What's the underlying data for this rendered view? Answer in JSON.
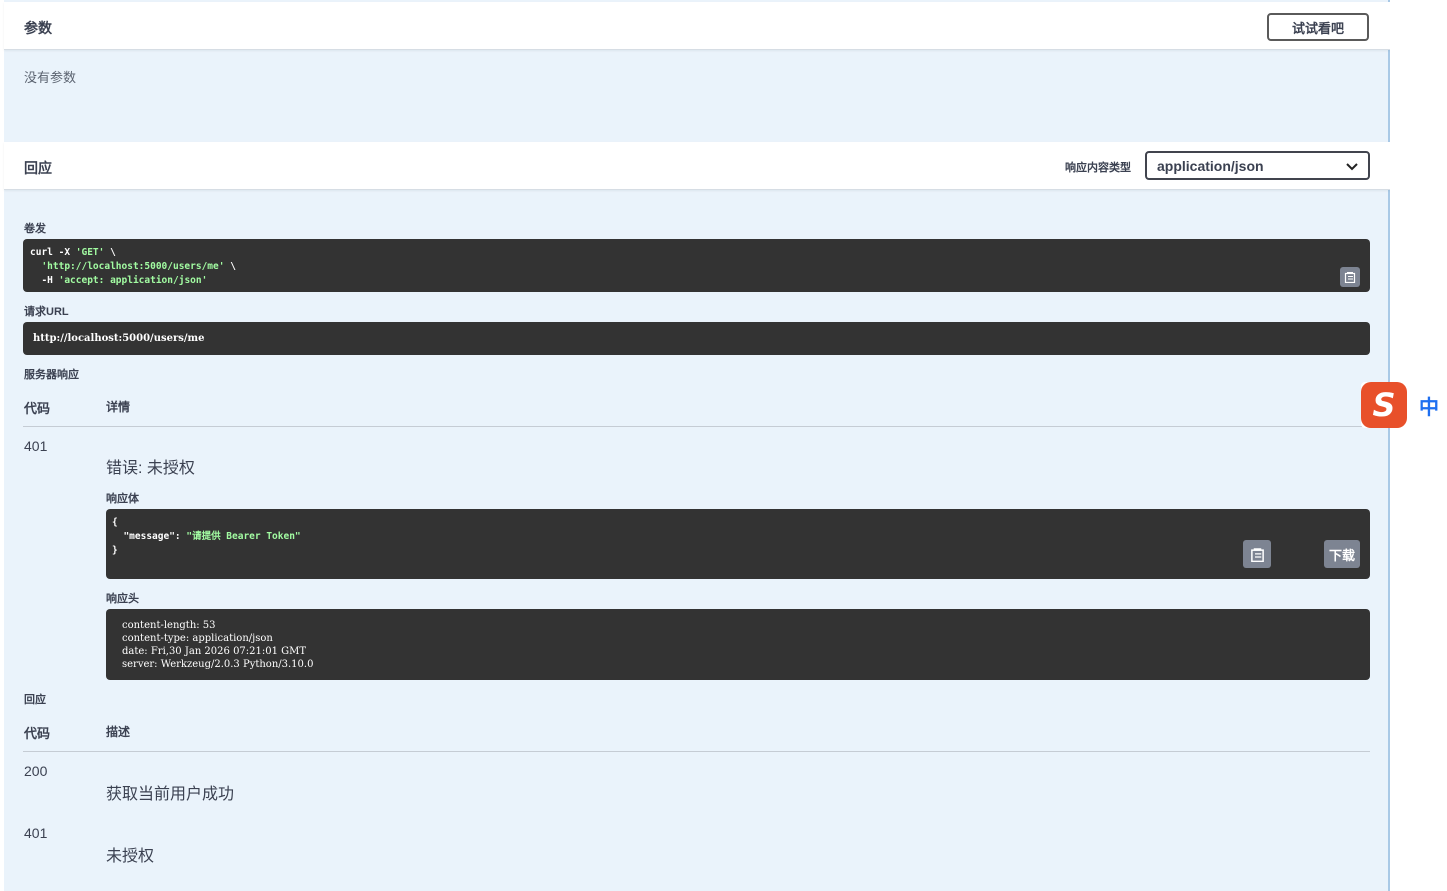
{
  "params": {
    "title": "参数",
    "try_button": "试试看吧",
    "empty_text": "没有参数"
  },
  "responses_header": {
    "title": "回应",
    "content_type_label": "响应内容类型",
    "content_type_value": "application/json"
  },
  "curl": {
    "label": "卷发",
    "line1_cmd": "curl -X ",
    "line1_method": "'GET'",
    "line1_tail": " \\",
    "line2": "  'http://localhost:5000/users/me'",
    "line2_tail": " \\",
    "line3_flag": "  -H ",
    "line3_header": "'accept: application/json'"
  },
  "request_url": {
    "label": "请求URL",
    "value": "http://localhost:5000/users/me"
  },
  "server_response": {
    "label": "服务器响应",
    "col_code": "代码",
    "col_details": "详情",
    "code": "401",
    "error_text": "错误: 未授权",
    "body_label": "响应体",
    "body_open": "{",
    "body_key": "  \"message\": ",
    "body_value": "\"请提供 Bearer Token\"",
    "body_close": "}",
    "download_button": "下载",
    "headers_label": "响应头",
    "headers": [
      "content-length: 53",
      "content-type: application/json",
      "date: Fri,30 Jan 2026 07:21:01 GMT",
      "server: Werkzeug/2.0.3 Python/3.10.0"
    ]
  },
  "responses_table": {
    "label": "回应",
    "col_code": "代码",
    "col_desc": "描述",
    "rows": [
      {
        "code": "200",
        "desc": "获取当前用户成功"
      },
      {
        "code": "401",
        "desc": "未授权"
      }
    ]
  },
  "ime": {
    "logo": "S",
    "lang": "中"
  }
}
